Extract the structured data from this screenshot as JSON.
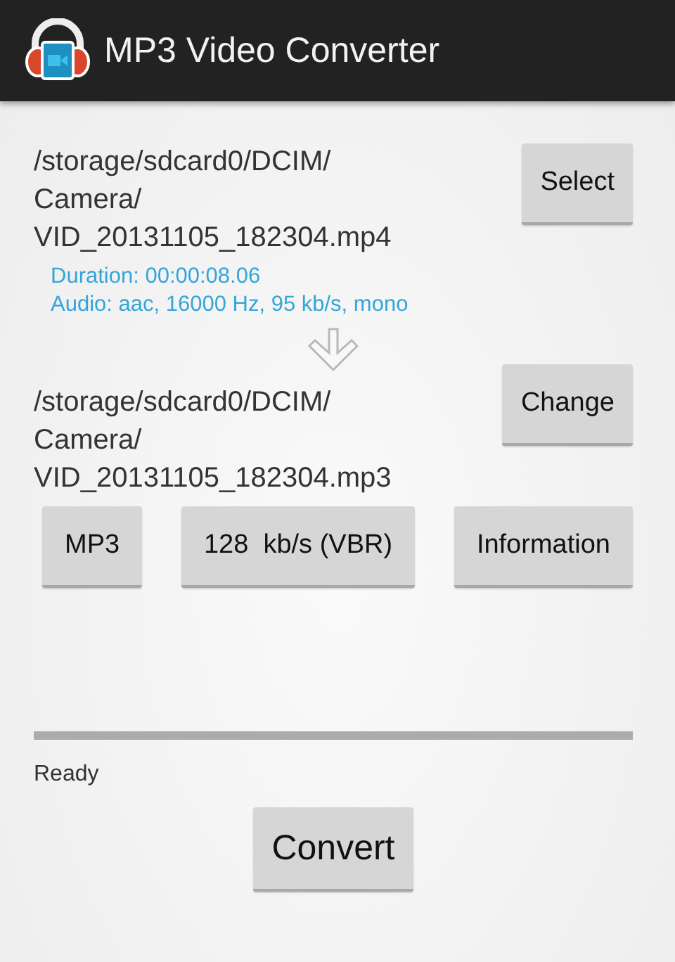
{
  "action_bar": {
    "title": "MP3 Video Converter"
  },
  "source": {
    "path_lines": [
      "/storage/sdcard0/DCIM/",
      "Camera/",
      "VID_20131105_182304.mp4"
    ],
    "button": "Select",
    "info": [
      "Duration: 00:00:08.06",
      "Audio: aac, 16000 Hz, 95 kb/s, mono"
    ]
  },
  "destination": {
    "path_lines": [
      "/storage/sdcard0/DCIM/",
      "Camera/",
      "VID_20131105_182304.mp3"
    ],
    "button": "Change"
  },
  "options": [
    "MP3",
    "128  kb/s (VBR)",
    "Information"
  ],
  "progress": {
    "level": 0
  },
  "status": "Ready",
  "convert_button": "Convert"
}
